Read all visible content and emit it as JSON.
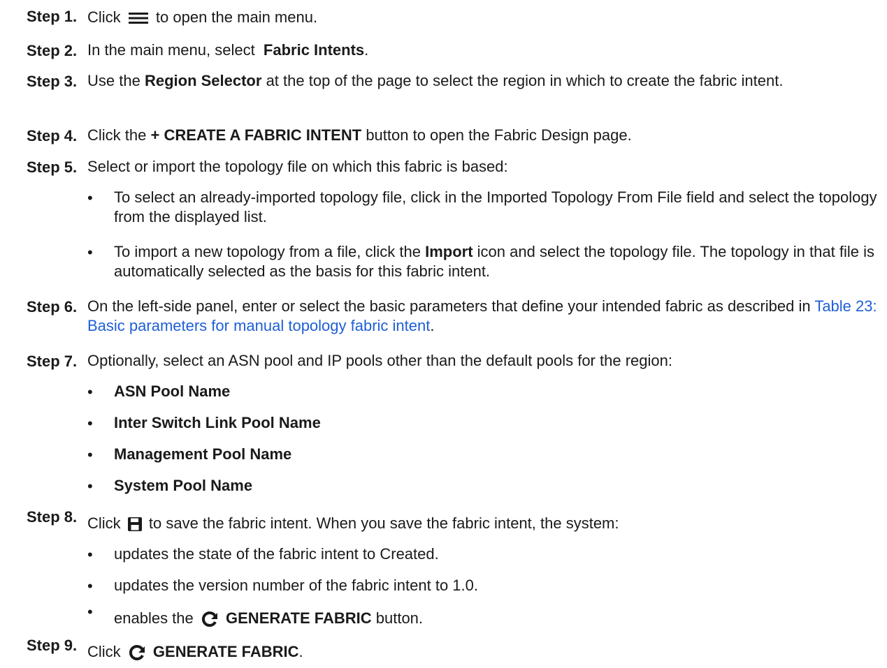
{
  "steps": [
    {
      "label": "Step 1.",
      "pre": "Click",
      "icon": "hamburger-menu-icon",
      "post": "to open the main menu."
    },
    {
      "label": "Step 2.",
      "pre": "In the main menu, select",
      "bold": "Fabric Intents",
      "post": "."
    },
    {
      "label": "Step 3.",
      "pre": "Use the",
      "bold": "Region Selector",
      "post": "at the top of the page to select the region in which to create the fabric intent."
    },
    {
      "label": "Step 4.",
      "pre": "Click the",
      "bold": "+ CREATE A FABRIC INTENT",
      "post": "button to open the Fabric Design page."
    },
    {
      "label": "Step 5.",
      "text": "Select or import the topology file on which this fabric is based:",
      "bullets": [
        {
          "text": "To select an already-imported topology file, click in the Imported Topology From File field and select the topology from the displayed list."
        },
        {
          "pre": "To import a new topology from a file, click the",
          "bold": "Import",
          "post": "icon and select the topology file. The topology in that file is automatically selected as the basis for this fabric intent."
        }
      ]
    },
    {
      "label": "Step 6.",
      "pre": "On the left-side panel, enter or select the basic parameters that define your intended fabric as described in",
      "link": "Table 23: Basic parameters for manual topology fabric intent",
      "post": "."
    },
    {
      "label": "Step 7.",
      "text": "Optionally, select an ASN pool and IP pools other than the default pools for the region:",
      "bullets": [
        "ASN Pool Name",
        "Inter Switch Link Pool Name",
        "Management Pool Name",
        "System Pool Name"
      ]
    },
    {
      "label": "Step 8.",
      "pre": "Click",
      "icon": "save-icon",
      "post": "to save the fabric intent. When you save the fabric intent, the system:",
      "bullets": [
        "updates the state of the fabric intent to Created.",
        "updates the version number of the fabric intent to 1.0.",
        {
          "pre": "enables the",
          "icon": "refresh-icon",
          "bold": "GENERATE FABRIC",
          "post": "button."
        }
      ]
    },
    {
      "label": "Step 9.",
      "pre": "Click",
      "icon": "refresh-icon",
      "bold": "GENERATE FABRIC",
      "post": "."
    }
  ],
  "bullet_char": "•",
  "colors": {
    "text": "#1a1a1a",
    "link": "#1f5fd6"
  }
}
